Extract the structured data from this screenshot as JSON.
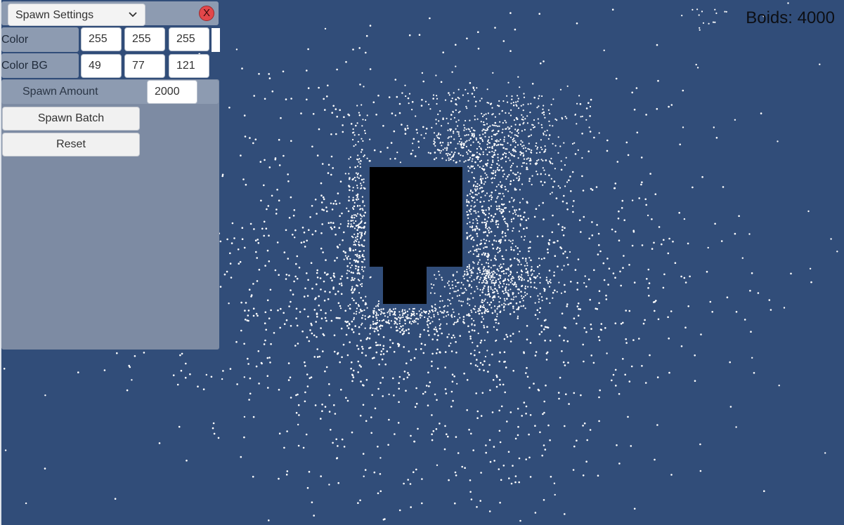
{
  "settings_menu": {
    "dropdown_label": "Spawn Settings",
    "close_label": "X"
  },
  "color_row": {
    "label": "Color",
    "r": "255",
    "g": "255",
    "b": "255"
  },
  "color_bg_row": {
    "label": "Color BG",
    "r": "49",
    "g": "77",
    "b": "121"
  },
  "spawn": {
    "amount_label": "Spawn Amount",
    "amount_value": "2000",
    "batch_button": "Spawn Batch",
    "reset_button": "Reset"
  },
  "hud": {
    "boids_counter": "Boids: 4000"
  },
  "colors": {
    "background": "#314d79",
    "boid": "#ffffff",
    "obstacle": "#000000",
    "close_button": "#e2474a"
  },
  "icons": [
    "chevron-down-icon",
    "close-icon"
  ]
}
